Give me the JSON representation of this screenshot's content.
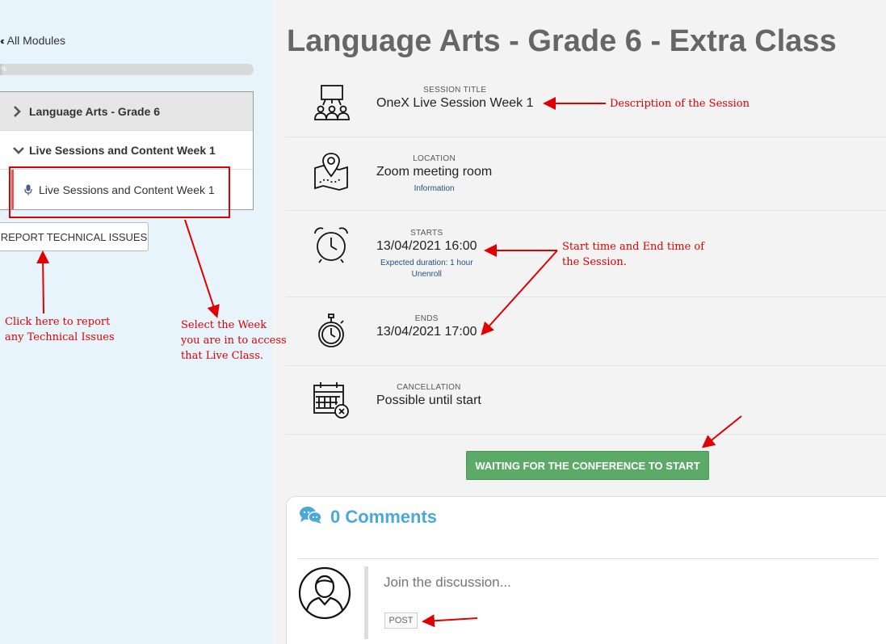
{
  "sidebar": {
    "back_label": "All Modules",
    "progress_text": "%",
    "progress_fraction": 0.01,
    "modules": [
      {
        "label": "Language Arts - Grade 6",
        "state": "collapsed"
      },
      {
        "label": "Live Sessions and Content Week 1",
        "state": "expanded"
      }
    ],
    "lesson": {
      "label": "Live Sessions and Content Week 1",
      "icon": "microphone-icon"
    },
    "report_label": "REPORT TECHNICAL ISSUES"
  },
  "main": {
    "title": "Language Arts - Grade 6 - Extra Class",
    "rows": {
      "session": {
        "label": "SESSION TITLE",
        "value": "OneX Live Session Week 1",
        "icon": "presentation-icon"
      },
      "location": {
        "label": "LOCATION",
        "value": "Zoom meeting room",
        "link": "Information",
        "icon": "map-pin-icon"
      },
      "starts": {
        "label": "STARTS",
        "value": "13/04/2021 16:00",
        "duration": "Expected duration: 1 hour",
        "link": "Unenroll",
        "icon": "alarm-clock-icon"
      },
      "ends": {
        "label": "ENDS",
        "value": "13/04/2021 17:00",
        "icon": "stopwatch-icon"
      },
      "cancellation": {
        "label": "CANCELLATION",
        "value": "Possible until start",
        "icon": "calendar-cancel-icon"
      }
    },
    "wait_button": "WAITING FOR THE CONFERENCE TO START",
    "comments": {
      "count_label": "0 Comments",
      "icon": "chat-bubbles-icon",
      "placeholder": "Join the discussion...",
      "post_label": "POST"
    }
  },
  "annotations": {
    "description": "Description of the Session",
    "start_end_1": "Start time and End time of",
    "start_end_2": "the Session.",
    "report_1": "Click here to report",
    "report_2": "any Technical Issues",
    "week_1": "Select the Week",
    "week_2": "you are in to access",
    "week_3": "that Live Class."
  },
  "colors": {
    "sidebar_bg": "#e8f4fc",
    "accent_green": "#5caa67",
    "accent_blue": "#4aa8dd",
    "annotation_red": "#e00000",
    "lesson_marker": "#e05a4e"
  }
}
